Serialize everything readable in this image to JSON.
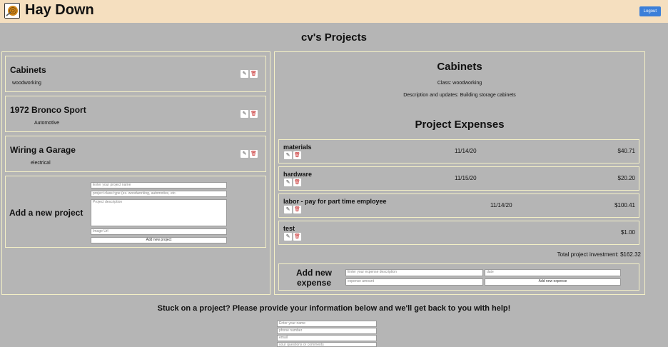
{
  "header": {
    "title": "Hay Down",
    "logout_label": "Logout",
    "logo_icon": "hay-bale-logo-icon"
  },
  "page_title": "cv's Projects",
  "projects": [
    {
      "name": "Cabinets",
      "class": "woodworking"
    },
    {
      "name": "1972 Bronco Sport",
      "class": "Automotive"
    },
    {
      "name": "Wiring a Garage",
      "class": "electrical"
    }
  ],
  "add_project": {
    "title": "Add a new project",
    "name_placeholder": "Enter your project name",
    "class_placeholder": "project class type (ex. woodworking, automotive, etc.",
    "description_placeholder": "Project description",
    "image_placeholder": "Image Url",
    "button_label": "Add new project"
  },
  "detail": {
    "title": "Cabinets",
    "class_line": "Class: woodworking",
    "description_line": "Description and updates: Building storage cabinets",
    "expenses_heading": "Project Expenses"
  },
  "expenses": [
    {
      "name": "materials",
      "date": "11/14/20",
      "amount": "$40.71"
    },
    {
      "name": "hardware",
      "date": "11/15/20",
      "amount": "$20.20"
    },
    {
      "name": "labor - pay for part time employee",
      "date": "11/14/20",
      "amount": "$100.41"
    },
    {
      "name": "test",
      "date": "",
      "amount": "$1.00"
    }
  ],
  "total_label": "Total project investment: $162.32",
  "add_expense": {
    "title": "Add new expense",
    "description_placeholder": "Enter your expense description",
    "date_placeholder": "date",
    "amount_placeholder": "expense amount",
    "button_label": "Add new expense"
  },
  "help": {
    "heading": "Stuck on a project? Please provide your information below and we'll get back to you with help!",
    "name_placeholder": "Enter your name",
    "phone_placeholder": "phone number",
    "email_placeholder": "email",
    "question_placeholder": "your questions or comments"
  },
  "icons": {
    "edit": "pencil-icon",
    "delete": "trash-icon"
  },
  "colors": {
    "header_bg": "#f5dfbf",
    "page_bg": "#b5b5b5",
    "border": "#f3efc6",
    "logout": "#3b7fd9",
    "delete": "#c62828"
  }
}
